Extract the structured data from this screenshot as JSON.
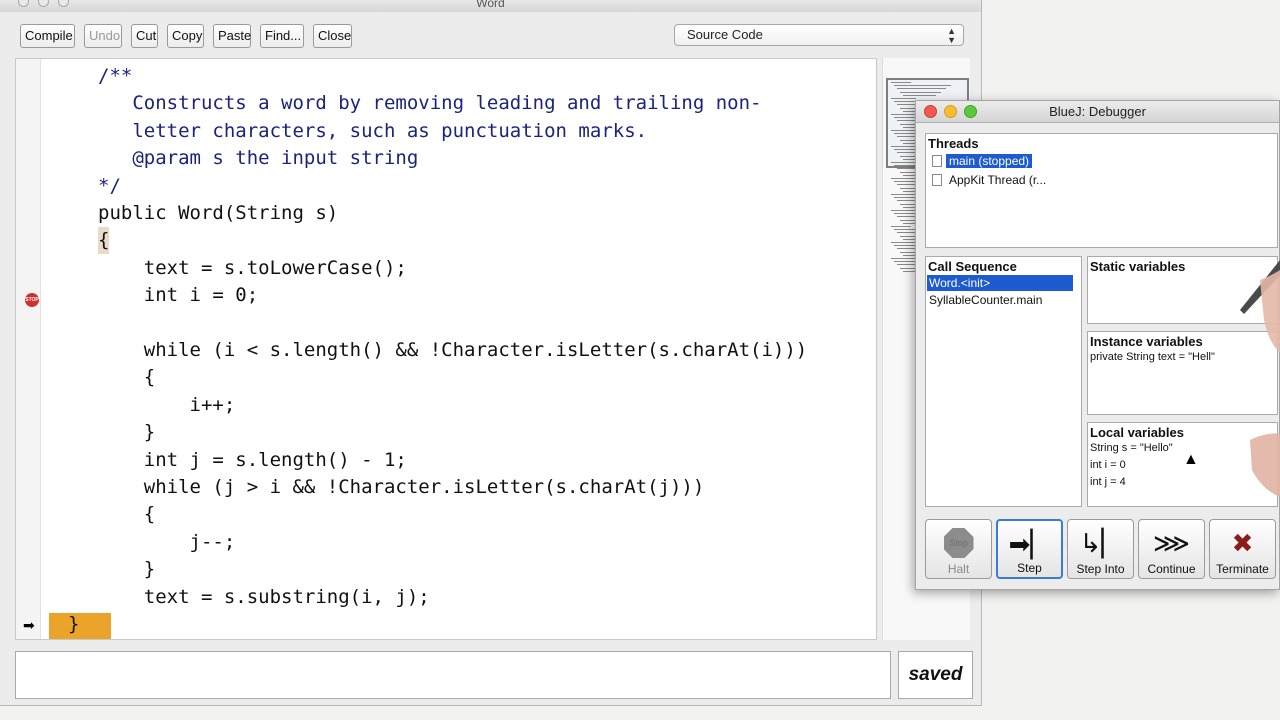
{
  "editor": {
    "window_title": "Word",
    "toolbar": {
      "compile": "Compile",
      "undo": "Undo",
      "cut": "Cut",
      "copy": "Copy",
      "paste": "Paste",
      "find": "Find...",
      "close": "Close"
    },
    "view_select": "Source Code",
    "code": [
      "/**",
      "   Constructs a word by removing leading and trailing non-",
      "   letter characters, such as punctuation marks.",
      "   @param s the input string",
      "*/",
      "public Word(String s)",
      "{",
      "    text = s.toLowerCase();",
      "    int i = 0;",
      "",
      "    while (i < s.length() && !Character.isLetter(s.charAt(i)))",
      "    {",
      "        i++;",
      "    }",
      "    int j = s.length() - 1;",
      "    while (j > i && !Character.isLetter(s.charAt(j)))",
      "    {",
      "        j--;",
      "    }",
      "    text = s.substring(i, j);",
      "}"
    ],
    "breakpoint_label": "STOP",
    "status": "saved"
  },
  "debugger": {
    "window_title": "BlueJ:  Debugger",
    "threads_title": "Threads",
    "threads": [
      "main (stopped)",
      "AppKit Thread (r..."
    ],
    "call_sequence_title": "Call Sequence",
    "call_sequence": [
      "Word.<init>",
      "SyllableCounter.main"
    ],
    "static_title": "Static variables",
    "instance_title": "Instance variables",
    "instance_vars": [
      "private String text = \"Hell\""
    ],
    "local_title": "Local variables",
    "local_vars": [
      "String s = \"Hello\"",
      "int i = 0",
      "int j = 4"
    ],
    "buttons": {
      "halt": "Halt",
      "step": "Step",
      "step_into": "Step Into",
      "continue": "Continue",
      "terminate": "Terminate"
    },
    "halt_icon_text": "Stop"
  }
}
